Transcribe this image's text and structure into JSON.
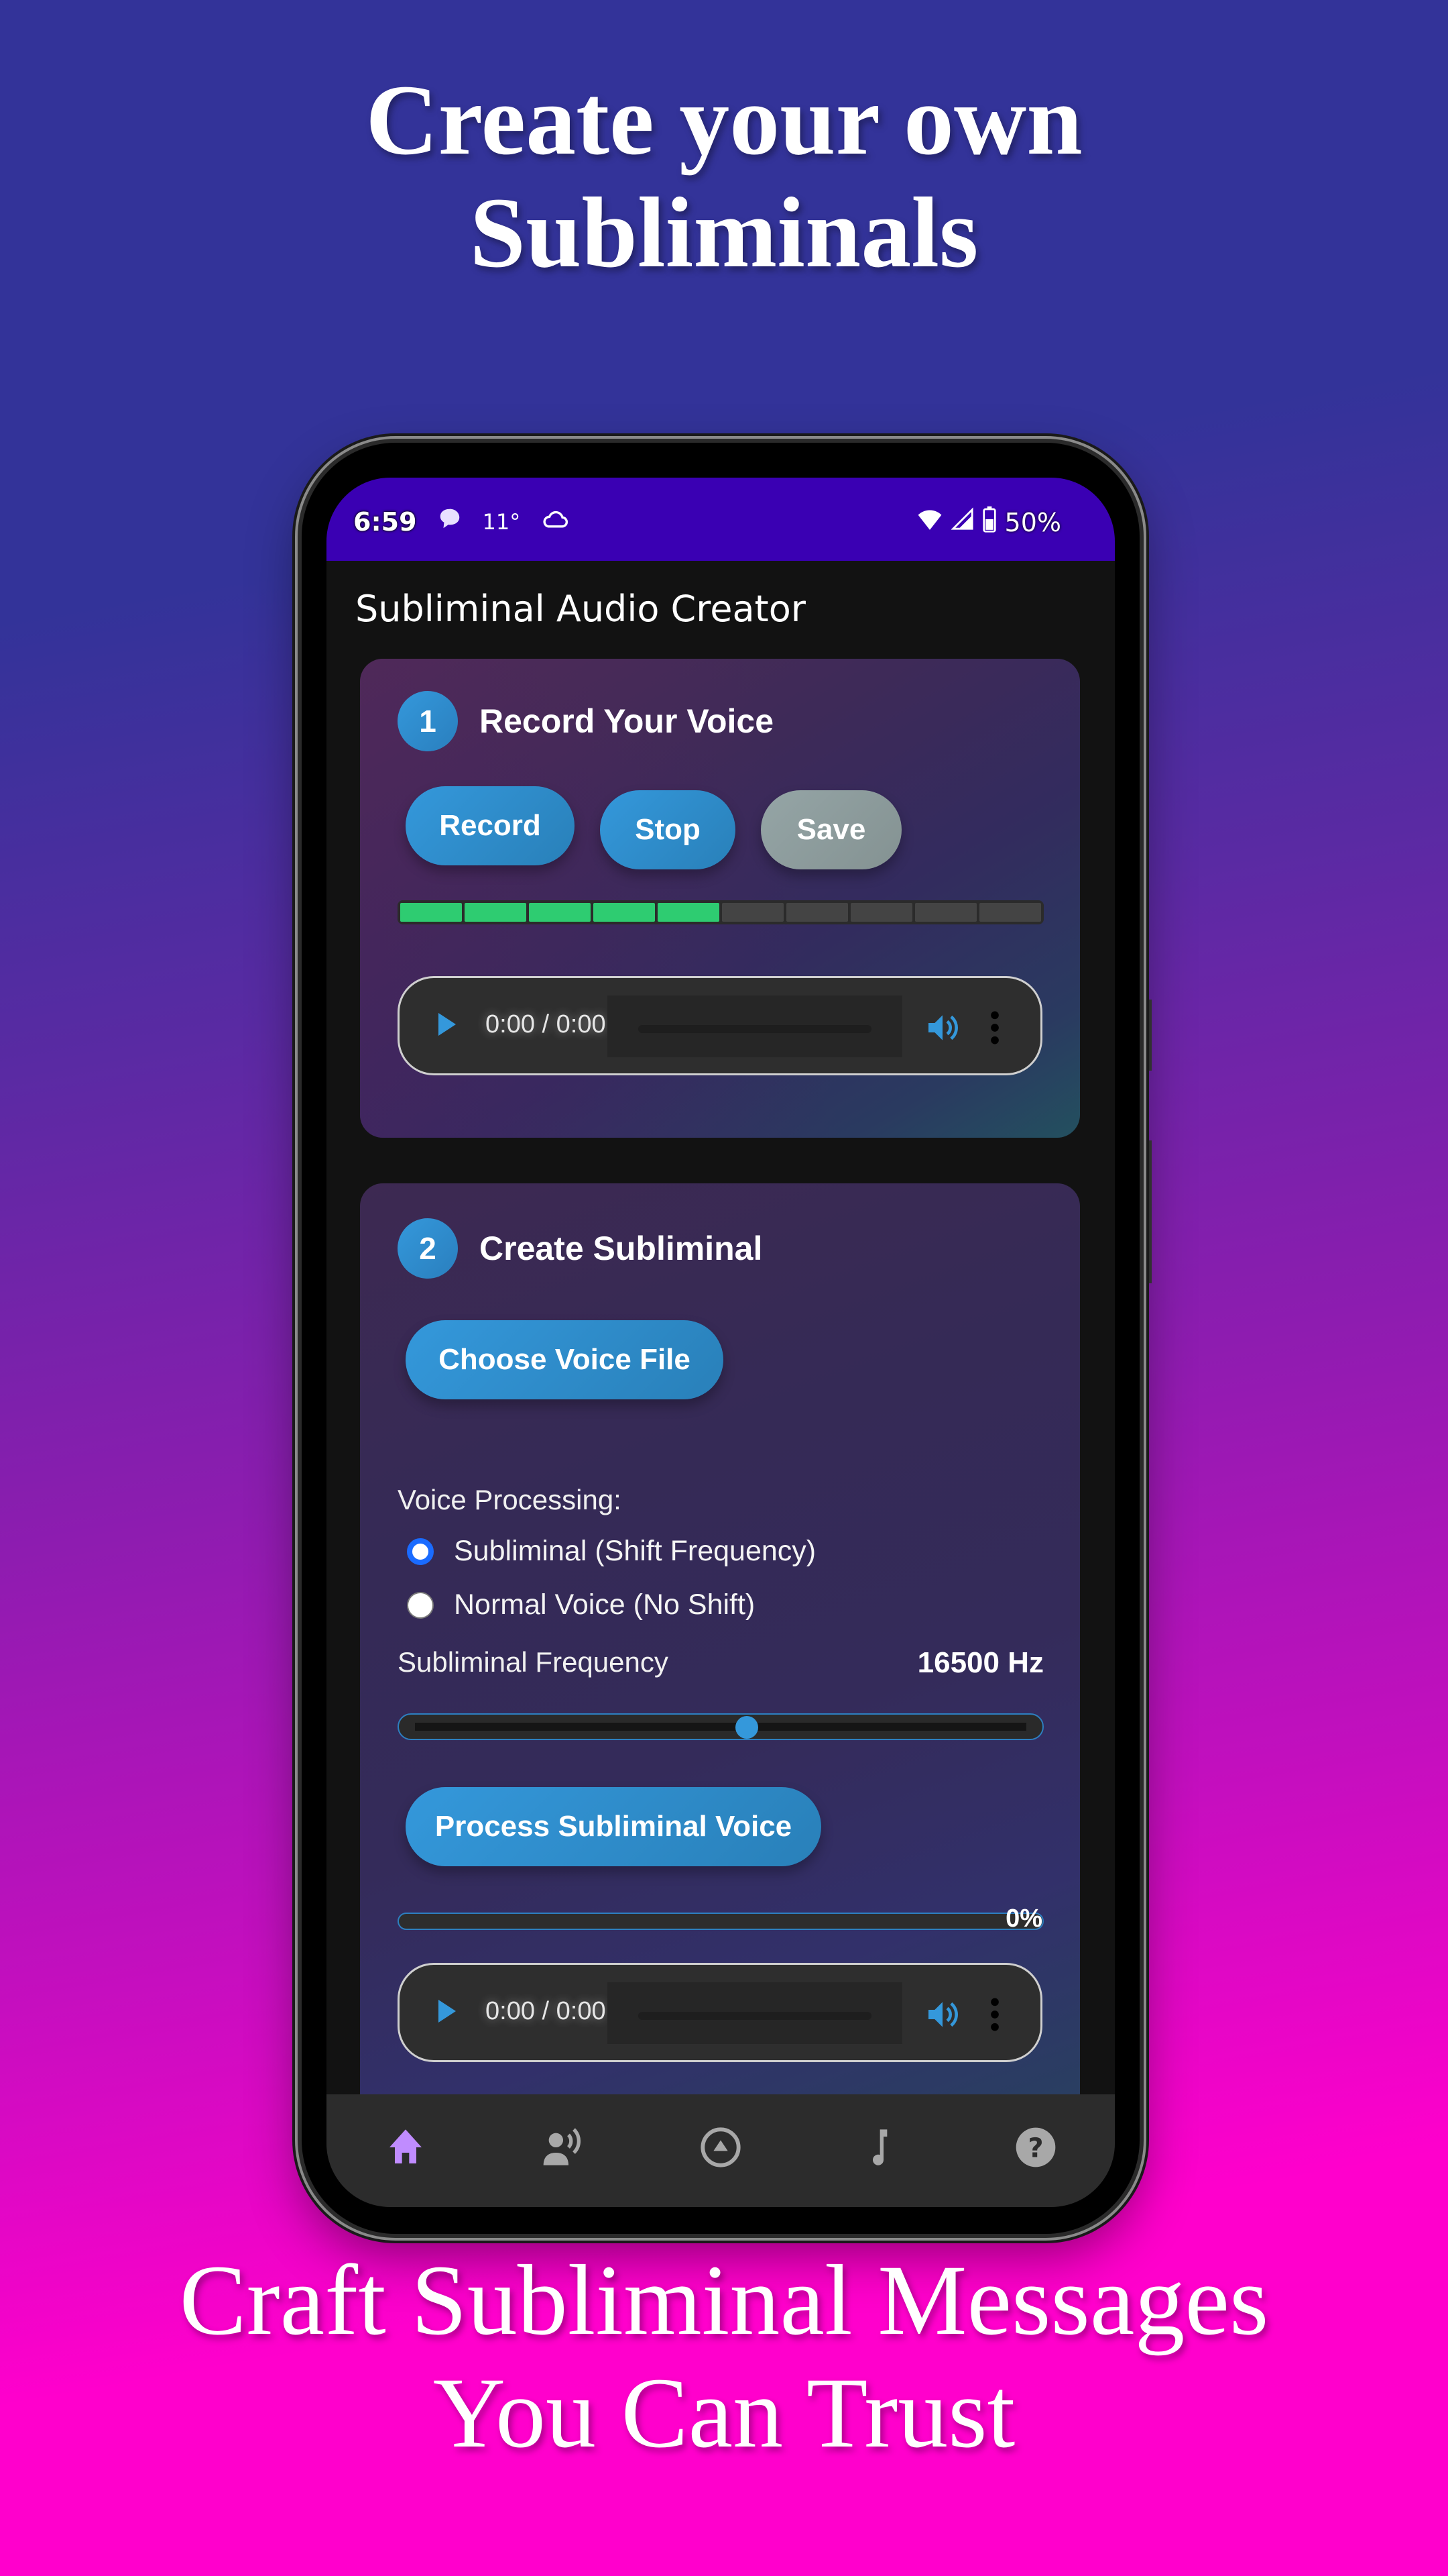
{
  "promo": {
    "headline_top": [
      "Create your own",
      "Subliminals"
    ],
    "headline_bottom": [
      "Craft Subliminal Messages",
      "You Can Trust"
    ]
  },
  "status_bar": {
    "time": "6:59",
    "temperature": "11°",
    "battery": "50%",
    "icons_left": [
      "chat-bubble-icon",
      "cloud-icon"
    ],
    "icons_right": [
      "wifi-icon",
      "signal-icon",
      "battery-icon"
    ]
  },
  "app": {
    "title": "Subliminal Audio Creator"
  },
  "step1": {
    "number": "1",
    "title": "Record Your Voice",
    "buttons": {
      "record": "Record",
      "stop": "Stop",
      "save": "Save"
    },
    "level_meter": {
      "segments": 10,
      "active": 5
    },
    "player": {
      "time": "0:00 / 0:00"
    }
  },
  "step2": {
    "number": "2",
    "title": "Create Subliminal",
    "choose_file": "Choose Voice File",
    "voice_processing_label": "Voice Processing:",
    "options": [
      {
        "label": "Subliminal (Shift Frequency)",
        "checked": true
      },
      {
        "label": "Normal Voice (No Shift)",
        "checked": false
      }
    ],
    "frequency_label": "Subliminal Frequency",
    "frequency_value": "16500 Hz",
    "frequency_slider_fraction": 0.54,
    "process_button": "Process Subliminal Voice",
    "progress_percent": 0,
    "progress_label": "0%",
    "player": {
      "time": "0:00 / 0:00"
    }
  },
  "bottom_nav": {
    "active": "home",
    "items": [
      "home",
      "voice",
      "upload",
      "music",
      "help"
    ]
  },
  "colors": {
    "accent": "#3498db",
    "meter_on": "#2ecc71",
    "status_bar": "#3a00b3",
    "nav_active": "#c08cff",
    "nav_inactive": "#a8a8a8"
  }
}
